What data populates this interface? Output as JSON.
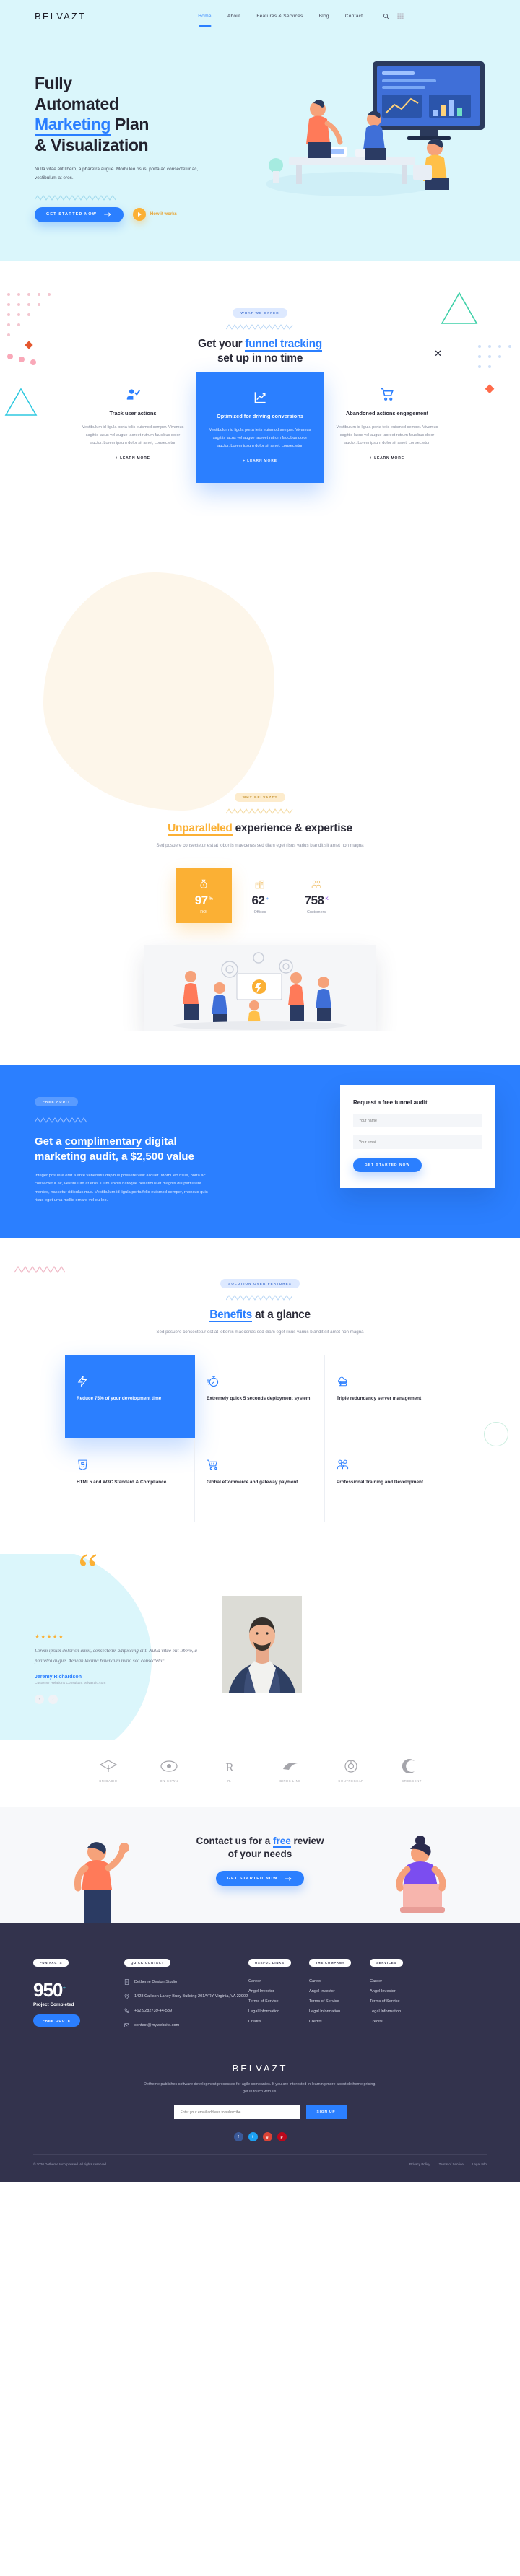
{
  "header": {
    "logo": "BELVAZT",
    "nav": [
      {
        "label": "Home",
        "active": true
      },
      {
        "label": "About",
        "active": false
      },
      {
        "label": "Features & Services",
        "active": false
      },
      {
        "label": "Blog",
        "active": false
      },
      {
        "label": "Contact",
        "active": false
      }
    ],
    "search_icon": "search-icon",
    "grid_icon": "grid-menu-icon"
  },
  "hero": {
    "title_1": "Fully",
    "title_2": "Automated",
    "title_hl": "Marketing",
    "title_3": " Plan",
    "title_4": "& Visualization",
    "paragraph": "Nulla vitae elit libero, a pharetra augue. Morbi leo risus, porta ac consectetur ac, vestibulum at eros.",
    "cta_label": "GET STARTED NOW",
    "video_label": "How it works"
  },
  "offer": {
    "pill": "WHAT WE OFFER",
    "title_plain_1": "Get your ",
    "title_hl": "funnel tracking",
    "title_plain_2": "set up in no time",
    "cards": [
      {
        "icon": "user-check-icon",
        "title": "Track user actions",
        "body": "Vestibulum id ligula porta felis euismod semper. Vivamus sagittis lacus vel augue laoreet rutrum faucibus dolor auctor. Lorem ipsum dolor sit amet, consectetur",
        "more": "+ LEARN MORE",
        "featured": false
      },
      {
        "icon": "chart-line-icon",
        "title": "Optimized for driving conversions",
        "body": "Vestibulum id ligula porta felis euismod semper. Vivamus sagittis lacus vel augue laoreet rutrum faucibus dolor auctor. Lorem ipsum dolor sit amet, consectetur",
        "more": "+ LEARN MORE",
        "featured": true
      },
      {
        "icon": "shopping-cart-icon",
        "title": "Abandoned actions engagement",
        "body": "Vestibulum id ligula porta felis euismod semper. Vivamus sagittis lacus vel augue laoreet rutrum faucibus dolor auctor. Lorem ipsum dolor sit amet, consectetur",
        "more": "+ LEARN MORE",
        "featured": false
      }
    ]
  },
  "expertise": {
    "pill": "WHY BELVAZT?",
    "title_hl": "Unparalleled",
    "title_plain": " experience & expertise",
    "subtitle": "Sed posuere consectetur est at lobortis maecenas sed diam eget risus varius blandit sit amet non magna",
    "stats": [
      {
        "icon": "money-bag-icon",
        "value": "97",
        "suffix": "%",
        "label": "ROI",
        "highlight": true
      },
      {
        "icon": "office-building-icon",
        "value": "62",
        "suffix": "+",
        "label": "Offices",
        "highlight": false
      },
      {
        "icon": "customers-group-icon",
        "value": "758",
        "suffix": "K",
        "label": "Customers",
        "highlight": false
      }
    ]
  },
  "audit": {
    "pill": "FREE AUDIT",
    "title_a": "Get a ",
    "title_hl": "complimentary",
    "title_b": " digital marketing audit, a $2,500 value",
    "paragraph": "Integer posuere erat a ante venenatis dapibus posuere velit aliquet. Morbi leo risus, porta ac consectetur ac, vestibulum at eros. Cum sociis natoque penatibus et magnis dis parturient montes, nascetur ridiculus mus. Vestibulum id ligula porta felis euismod semper, rhoncus quis risus eget urna mollis ornare vel eu leo.",
    "form": {
      "heading": "Request a free funnel audit",
      "name_placeholder": "Your name",
      "email_placeholder": "Your email",
      "submit_label": "GET STARTED NOW"
    }
  },
  "benefits": {
    "pill": "SOLUTION OVER FEATURES",
    "title_hl": "Benefits",
    "title_plain": " at a glance",
    "subtitle": "Sed posuere consectetur est at lobortis maecenas sed diam eget risus varius blandit sit amet non magna",
    "items": [
      {
        "icon": "lightning-bolt-icon",
        "title": "Reduce 75% of your development time",
        "highlight": true
      },
      {
        "icon": "stopwatch-icon",
        "title": "Extremely quick 5 seconds deployment system",
        "highlight": false
      },
      {
        "icon": "cloud-server-icon",
        "title": "Triple redundancy server management",
        "highlight": false
      },
      {
        "icon": "html5-shield-icon",
        "title": "HTML5 and W3C Standard & Compliance",
        "highlight": false
      },
      {
        "icon": "shopping-cart-outline-icon",
        "title": "Global eCommerce and gateway payment",
        "highlight": false
      },
      {
        "icon": "people-group-icon",
        "title": "Professional Training and Development",
        "highlight": false
      }
    ]
  },
  "testimonial": {
    "quote_mark": "“",
    "stars": "★★★★★",
    "text": "Lorem ipsum dolor sit amet, consectetur adipiscing elit. Nulla vitae elit libero, a pharetra augue. Aenean lacinia bibendum nulla sed consectetur.",
    "name": "Jeremy Richardson",
    "role": "Customer Relations Consultant belvazt.io.com",
    "prev_icon": "chevron-left-icon",
    "next_icon": "chevron-right-icon"
  },
  "clients": [
    {
      "name": "BRIGADIO"
    },
    {
      "name": "ON-COWN"
    },
    {
      "name": "R."
    },
    {
      "name": "BIRDS LINE"
    },
    {
      "name": "CONTREGEAR"
    },
    {
      "name": "CRESCENT"
    }
  ],
  "cta": {
    "title_a": "Contact us for a ",
    "title_hl": "free",
    "title_b": "review",
    "title_c": "of your needs",
    "button": "GET STARTED NOW"
  },
  "footer": {
    "columns": {
      "funfacts": {
        "pill": "FUN FACTS",
        "number": "950",
        "sup": "+",
        "label": "Project Completed",
        "button": "FREE QUOTE"
      },
      "contact": {
        "pill": "QUICK CONTACT",
        "rows": [
          {
            "icon": "building-icon",
            "text": "Detheme Design Studio"
          },
          {
            "icon": "map-pin-icon",
            "text": "1428 Callison Laney Buoy Building 201/VRY Virginia, VA 22902"
          },
          {
            "icon": "phone-icon",
            "text": "+62 9282739-44-539"
          },
          {
            "icon": "mail-icon",
            "text": "contact@mywebsite.com"
          }
        ]
      },
      "useful": {
        "pill": "USEFUL LINKS",
        "links": [
          "Career",
          "Angel Investor",
          "Terms of Service",
          "Legal Information",
          "Credits"
        ]
      },
      "company": {
        "pill": "THE COMPANY",
        "links": [
          "Career",
          "Angel Investor",
          "Terms of Service",
          "Legal Information",
          "Credits"
        ]
      },
      "services": {
        "pill": "SERVICES",
        "links": [
          "Career",
          "Angel Investor",
          "Terms of Service",
          "Legal Information",
          "Credits"
        ]
      }
    },
    "brand": {
      "logo": "BELVAZT",
      "tagline": "Detheme publishes software development processes for agile companies. If you are interested in learning more about detheme pricing, get in touch with us."
    },
    "subscribe": {
      "placeholder": "Enter your email address to subscribe",
      "button": "SIGN UP"
    },
    "socials": [
      {
        "name": "facebook-icon",
        "glyph": "f",
        "color": "#3b5998"
      },
      {
        "name": "twitter-icon",
        "glyph": "t",
        "color": "#1da1f2"
      },
      {
        "name": "google-plus-icon",
        "glyph": "g",
        "color": "#db4437"
      },
      {
        "name": "pinterest-icon",
        "glyph": "p",
        "color": "#bd081c"
      }
    ],
    "bottom": {
      "copyright": "© 2020 Detheme Incorporated. All rights reserved.",
      "links": [
        "Privacy Policy",
        "Terms of Service",
        "Legal Info"
      ]
    }
  },
  "colors": {
    "accent_blue": "#2b7fff",
    "accent_amber": "#fbb034",
    "hero_bg": "#daf6fb",
    "footer_bg": "#33334d"
  }
}
